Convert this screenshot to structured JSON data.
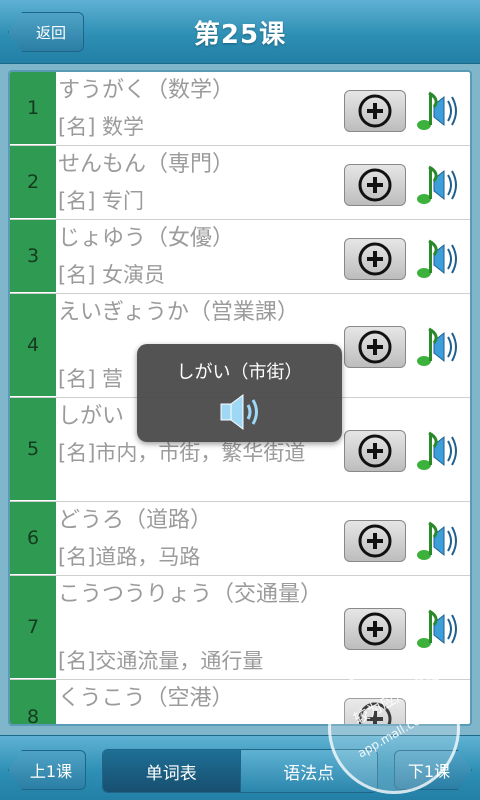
{
  "header": {
    "back_label": "返回",
    "title": "第25课"
  },
  "rows": [
    {
      "num": "1",
      "word": "すうがく（数学）",
      "meaning": "[名] 数学"
    },
    {
      "num": "2",
      "word": "せんもん（専門）",
      "meaning": "[名] 专门"
    },
    {
      "num": "3",
      "word": "じょゆう（女優）",
      "meaning": "[名] 女演员"
    },
    {
      "num": "4",
      "word": "えいぎょうか（営業課）",
      "meaning": "[名] 营"
    },
    {
      "num": "5",
      "word": "しがい",
      "meaning": "[名]市内，市街，繁华街道"
    },
    {
      "num": "6",
      "word": "どうろ（道路）",
      "meaning": "[名]道路，马路"
    },
    {
      "num": "7",
      "word": "こうつうりょう（交通量）",
      "meaning": "[名]交通流量，通行量"
    },
    {
      "num": "8",
      "word": "くうこう（空港）",
      "meaning": ""
    }
  ],
  "toast": {
    "text": "しがい（市街）",
    "icon": "speaker-icon"
  },
  "footer": {
    "prev_label": "上1课",
    "tab_words": "单词表",
    "tab_grammar": "语法点",
    "next_label": "下1课"
  },
  "watermark": {
    "brand": "较为应用市场",
    "url": "app.mall.com"
  },
  "colors": {
    "accent": "#2e8fb5",
    "row_number_bg": "#2f9b52",
    "text_muted": "#9b9b9b"
  }
}
